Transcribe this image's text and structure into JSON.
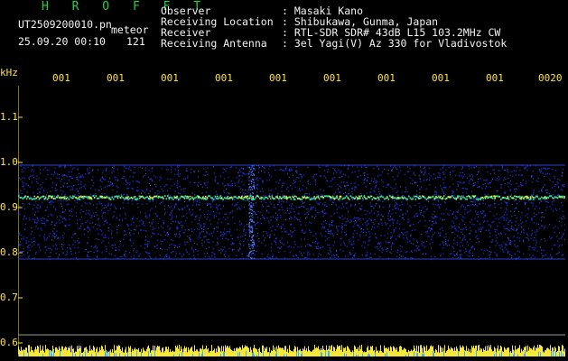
{
  "header": {
    "brand": "H R O F F T",
    "filename": "UT2509200010.pn",
    "tag": "meteor",
    "datetime": "25.09.20 00:10",
    "count": "121",
    "fields": [
      {
        "label": "Observer",
        "value": ": Masaki Kano"
      },
      {
        "label": "Receiving Location",
        "value": ": Shibukawa, Gunma, Japan"
      },
      {
        "label": "Receiver",
        "value": ": RTL-SDR SDR# 43dB L15 103.2MHz CW"
      },
      {
        "label": "Receiving Antenna",
        "value": ": 3el Yagi(V) Az 330 for Vladivostok"
      }
    ]
  },
  "axis": {
    "unit": "kHz",
    "time_ticks": [
      "001",
      "001",
      "001",
      "001",
      "001",
      "001",
      "001",
      "001",
      "001",
      "0020"
    ],
    "freq_ticks": [
      "1.1",
      "1.0",
      "0.9",
      "0.8",
      "0.7",
      "0.6"
    ]
  },
  "colors": {
    "brand": "#1fd43a",
    "text": "#f2f2f2",
    "axis": "#ffe23a",
    "signal": "#2040ff"
  }
}
